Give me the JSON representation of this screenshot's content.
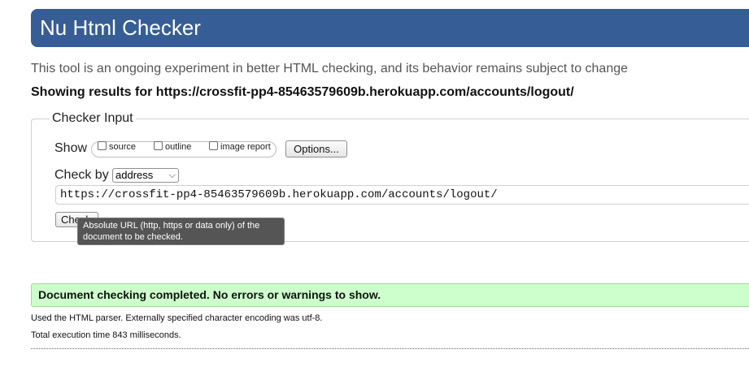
{
  "header": {
    "title": "Nu Html Checker"
  },
  "intro": "This tool is an ongoing experiment in better HTML checking, and its behavior remains subject to change",
  "showing": "Showing results for https://crossfit-pp4-85463579609b.herokuapp.com/accounts/logout/",
  "checker_input": {
    "legend": "Checker Input",
    "show_label": "Show",
    "options": [
      {
        "label": "source",
        "checked": false
      },
      {
        "label": "outline",
        "checked": false
      },
      {
        "label": "image report",
        "checked": false
      }
    ],
    "options_button": "Options...",
    "check_by_label": "Check by",
    "check_by_selected": "address",
    "url_value": "https://crossfit-pp4-85463579609b.herokuapp.com/accounts/logout/",
    "check_button": "Check",
    "tooltip": "Absolute URL (http, https or data only) of the document to be checked."
  },
  "results": {
    "success": "Document checking completed. No errors or warnings to show.",
    "parser_info": "Used the HTML parser. Externally specified character encoding was utf-8.",
    "time_info": "Total execution time 843 milliseconds."
  },
  "colors": {
    "header_bg": "#365d95",
    "success_bg": "#ccffcc",
    "tooltip_bg": "#555555"
  }
}
